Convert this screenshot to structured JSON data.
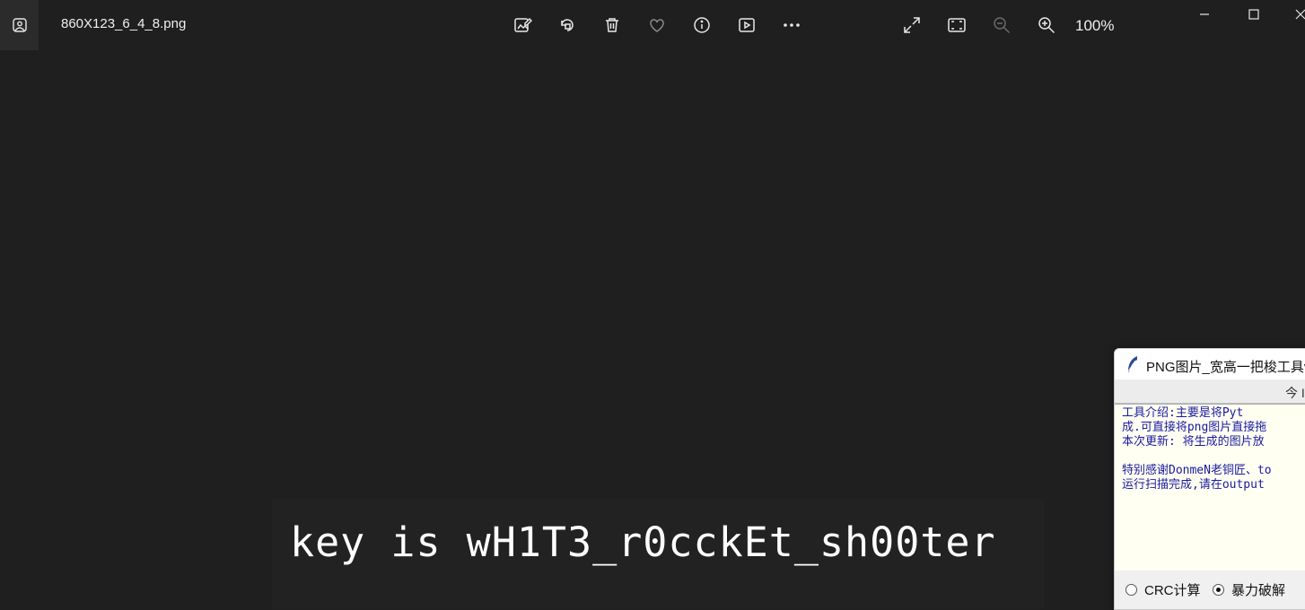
{
  "titlebar": {
    "filename": "860X123_6_4_8.png",
    "zoom_level": "100%"
  },
  "toolbar_icons": [
    "edit-image-icon",
    "rotate-icon",
    "delete-icon",
    "favorite-icon",
    "info-icon",
    "slideshow-icon",
    "more-icon"
  ],
  "view_icons": [
    "fullscreen-icon",
    "fit-to-window-icon",
    "zoom-out-icon",
    "zoom-in-icon"
  ],
  "window_controls": [
    "minimize-icon",
    "maximize-icon",
    "close-icon"
  ],
  "photo": {
    "text": "key is wH1T3_r0cckEt_sh00ter"
  },
  "tool_window": {
    "title": "PNG图片_宽高一把梭工具v",
    "banner": "今 I",
    "lines": [
      "    工具介绍:主要是将Pyt",
      "成.可直接将png图片直接拖",
      "本次更新: 将生成的图片放",
      "",
      "特别感谢DonmeN老铜匠、to",
      "运行扫描完成,请在output"
    ],
    "options": {
      "crc_label": "CRC计算",
      "brute_label": "暴力破解",
      "selected": "暴力破解"
    }
  },
  "colors": {
    "background": "#1f1f1f",
    "photo_bg": "#222222",
    "tool_text_color": "#1a1aa0",
    "tool_text_bg": "#fffff2"
  }
}
